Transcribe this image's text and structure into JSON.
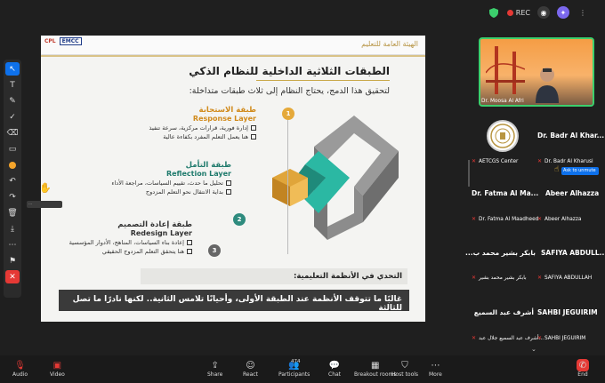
{
  "topbar": {
    "rec_label": "REC",
    "icons": [
      "shield-icon",
      "camera-icon",
      "spark-icon",
      "menu-icon"
    ]
  },
  "slide": {
    "title": "الطبقات الثلاثية الداخلية للنظام الذكي",
    "subtitle": "لتحقيق هذا الدمج، يحتاج النظام إلى ثلاث طبقات متداخلة:",
    "logo_left": "CPL",
    "logo_right": "EMCC",
    "brand": "الهيئة العامة للتعليم",
    "layers": [
      {
        "number": "1",
        "title_ar": "طبقة الاستجابة",
        "title_en": "Response Layer",
        "bullets": [
          "إدارة فورية، قرارات مركزية، سرعة تنفيذ",
          "هنا يعمل التعلم المفرد بكفاءة عالية"
        ]
      },
      {
        "number": "2",
        "title_ar": "طبقة التأمل",
        "title_en": "Reflection Layer",
        "bullets": [
          "تحليل ما حدث، تقييم السياسات، مراجعة الأداء",
          "بداية الانتقال نحو التعلم المزدوج"
        ]
      },
      {
        "number": "3",
        "title_ar": "طبقة إعادة التصميم",
        "title_en": "Redesign Layer",
        "bullets": [
          "إعادة بناء السياسات، المناهج، الأدوار المؤسسية",
          "هنا يتحقق التعلم المزدوج الحقيقي"
        ]
      }
    ],
    "challenge_label": "التحدي في الأنظمة التعليمية:",
    "banner_text": "غالبًا ما تتوقف الأنظمة عند الطبقة الأولى، وأحيانًا تلامس الثانية.. لكنها نادرًا ما تصل للثالثة"
  },
  "participants": {
    "speaker_name": "Dr. Moosa Al Afri",
    "tiles": [
      {
        "label": "Dr. Badr Al Khar...",
        "sub": "Dr. Badr Al Kharusi"
      },
      {
        "label": "AETCGS Center",
        "sub": "AETCGS Center"
      },
      {
        "label": "Dr. Fatma Al Ma...",
        "sub": "Dr. Fatma Al Maadheed"
      },
      {
        "label": "Abeer Alhazza",
        "sub": "Abeer Alhazza"
      },
      {
        "label": "بابكر بشير محمد ب...",
        "sub": "بابكر بشير محمد بشير"
      },
      {
        "label": "SAFIYA ABDULL...",
        "sub": "SAFIYA ABDULLAH"
      },
      {
        "label": "أشرف عبد السميع",
        "sub": "أشرف عبد السميع جلال عبد..."
      },
      {
        "label": "SAHBI JEGUIRIM",
        "sub": "SAHBI JEGUIRIM"
      }
    ],
    "hover_badge": "Ask to unmute",
    "floating_tag": "..."
  },
  "toolbar": {
    "audio": "Audio",
    "video": "Video",
    "share": "Share",
    "react": "React",
    "participants": "Participants",
    "participants_count": "474",
    "chat": "Chat",
    "breakout": "Breakout rooms",
    "host_tools": "Host tools",
    "more": "More",
    "end": "End"
  }
}
